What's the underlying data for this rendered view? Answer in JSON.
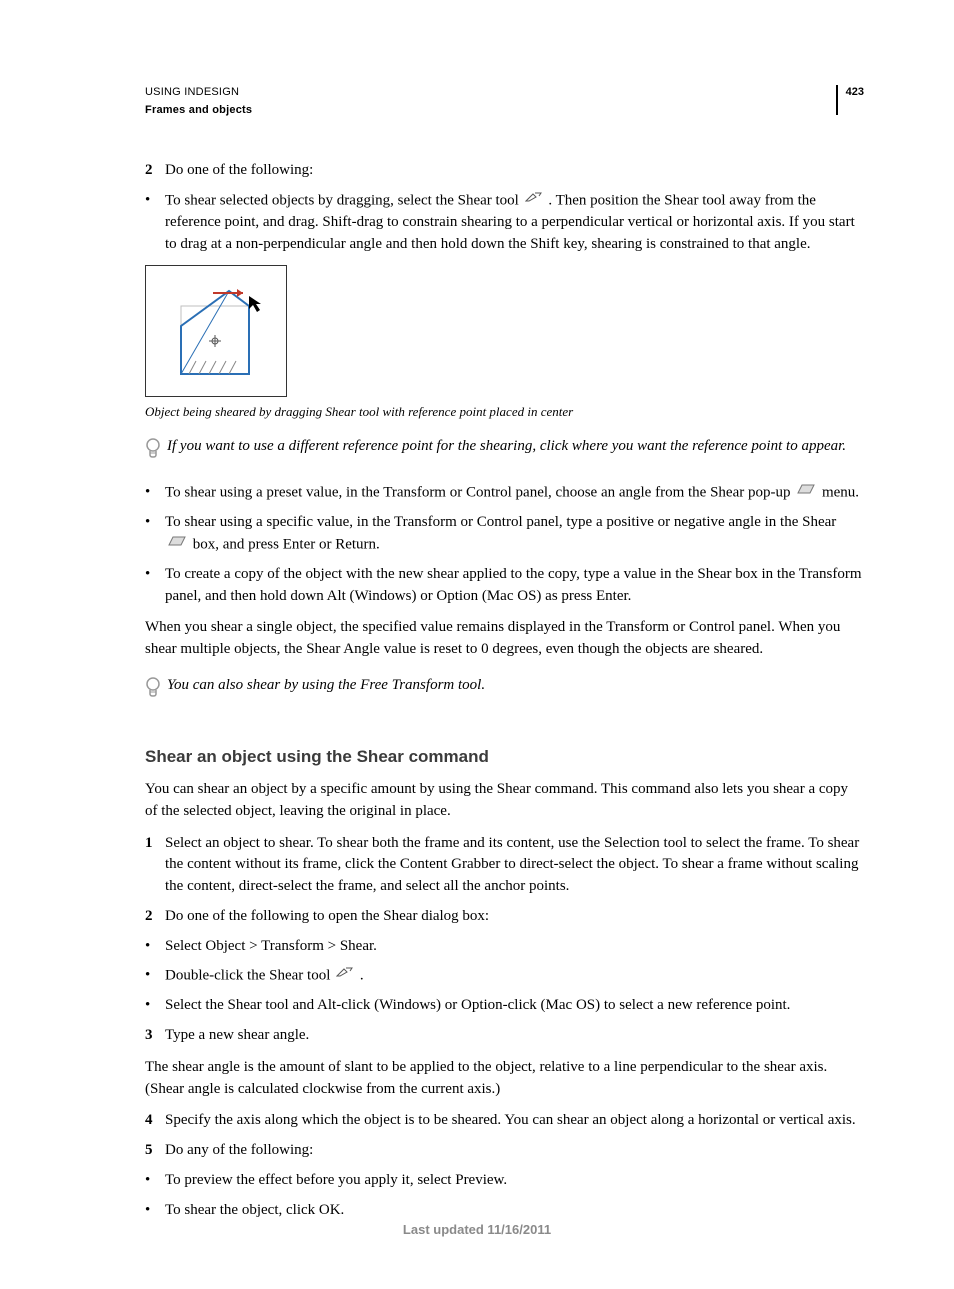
{
  "header": {
    "doc_title": "USING INDESIGN",
    "section": "Frames and objects",
    "page_number": "423"
  },
  "step2_label": "2",
  "step2_text": "Do one of the following:",
  "bullet_shear_drag_a": "To shear selected objects by dragging, select the Shear tool ",
  "bullet_shear_drag_b": ". Then position the Shear tool away from the reference point, and drag. Shift-drag to constrain shearing to a perpendicular vertical or horizontal axis. If you start to drag at a non-perpendicular angle and then hold down the Shift key, shearing is constrained to that angle.",
  "figure_caption": "Object being sheared by dragging Shear tool with reference point placed in center",
  "tip_refpoint": "If you want to use a different reference point for the shearing, click where you want the reference point to appear.",
  "bullet_preset_a": "To shear using a preset value, in the Transform or Control panel, choose an angle from the Shear pop-up ",
  "bullet_preset_b": " menu.",
  "bullet_specific_a": "To shear using a specific value, in the Transform or Control panel, type a positive or negative angle in the Shear ",
  "bullet_specific_b": " box, and press Enter or Return.",
  "bullet_copy": "To create a copy of the object with the new shear applied to the copy, type a value in the Shear box in the Transform panel, and then hold down Alt (Windows) or Option (Mac OS) as press Enter.",
  "para_single": "When you shear a single object, the specified value remains displayed in the Transform or Control panel. When you shear multiple objects, the Shear Angle value is reset to 0 degrees, even though the objects are sheared.",
  "tip_free_transform": "You can also shear by using the Free Transform tool.",
  "h3": "Shear an object using the Shear command",
  "para_intro": "You can shear an object by a specific amount by using the Shear command. This command also lets you shear a copy of the selected object, leaving the original in place.",
  "s_step1_label": "1",
  "s_step1_text": "Select an object to shear. To shear both the frame and its content, use the Selection tool to select the frame. To shear the content without its frame, click the Content Grabber to direct-select the object. To shear a frame without scaling the content, direct-select the frame, and select all the anchor points.",
  "s_step2_label": "2",
  "s_step2_text": "Do one of the following to open the Shear dialog box:",
  "s_bullet_menu": "Select Object > Transform > Shear.",
  "s_bullet_dblclick_a": "Double-click the Shear tool ",
  "s_bullet_dblclick_b": ".",
  "s_bullet_altclick": "Select the Shear tool and Alt-click (Windows) or Option-click (Mac OS) to select a new reference point.",
  "s_step3_label": "3",
  "s_step3_text": "Type a new shear angle.",
  "para_angle": "The shear angle is the amount of slant to be applied to the object, relative to a line perpendicular to the shear axis. (Shear angle is calculated clockwise from the current axis.)",
  "s_step4_label": "4",
  "s_step4_text": "Specify the axis along which the object is to be sheared. You can shear an object along a horizontal or vertical axis.",
  "s_step5_label": "5",
  "s_step5_text": "Do any of the following:",
  "s_bullet_preview": "To preview the effect before you apply it, select Preview.",
  "s_bullet_ok": "To shear the object, click OK.",
  "footer": "Last updated 11/16/2011"
}
